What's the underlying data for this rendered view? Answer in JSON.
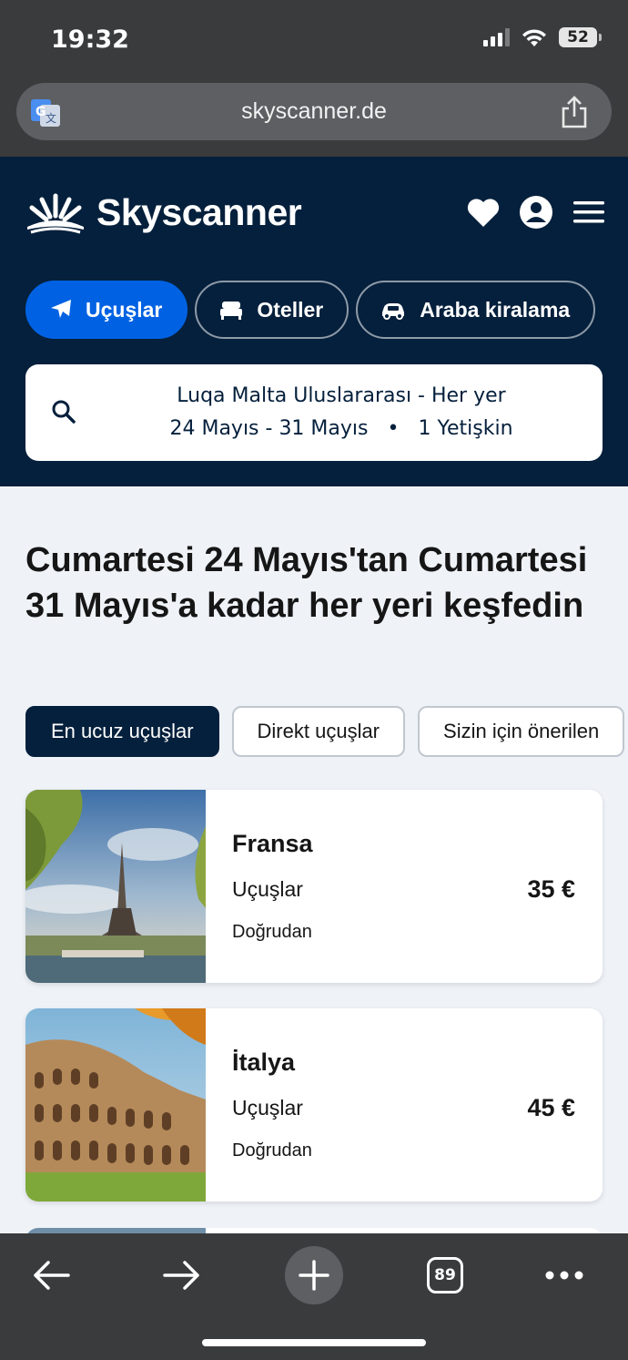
{
  "status_bar": {
    "time": "19:32",
    "battery": "52"
  },
  "browser": {
    "url": "skyscanner.de",
    "tab_count": "89"
  },
  "header": {
    "brand": "Skyscanner",
    "tabs": [
      {
        "label": "Uçuşlar",
        "icon": "plane-icon",
        "active": true
      },
      {
        "label": "Oteller",
        "icon": "bed-icon",
        "active": false
      },
      {
        "label": "Araba kiralama",
        "icon": "car-icon",
        "active": false
      }
    ]
  },
  "search": {
    "route": "Luqa Malta Uluslararası - Her yer",
    "dates": "24 Mayıs - 31 Mayıs",
    "separator": "•",
    "travellers": "1 Yetişkin"
  },
  "headline": "Cumartesi 24 Mayıs'tan Cumartesi 31 Mayıs'a kadar her yeri keşfedin",
  "filters": [
    {
      "label": "En ucuz uçuşlar",
      "active": true
    },
    {
      "label": "Direkt uçuşlar",
      "active": false
    },
    {
      "label": "Sizin için önerilen",
      "active": false
    }
  ],
  "destinations": [
    {
      "name": "Fransa",
      "category": "Uçuşlar",
      "price": "35 €",
      "type": "Doğrudan"
    },
    {
      "name": "İtalya",
      "category": "Uçuşlar",
      "price": "45 €",
      "type": "Doğrudan"
    }
  ],
  "colors": {
    "brand_dark": "#05203c",
    "accent_blue": "#0062e3",
    "browser_chrome": "#3a3b3d"
  }
}
